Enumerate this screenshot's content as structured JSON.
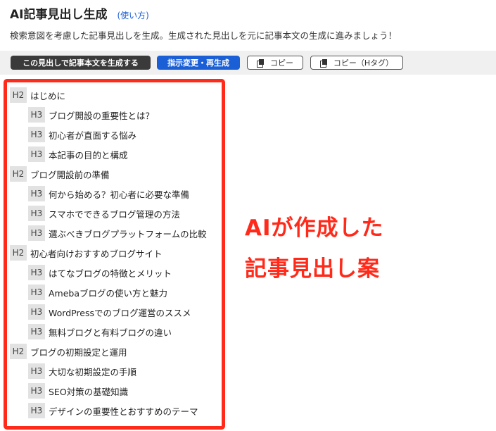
{
  "header": {
    "title": "AI記事見出し生成",
    "howto": "(使い方)"
  },
  "description": "検索意図を考慮した記事見出しを生成。生成された見出しを元に記事本文の生成に進みましょう！",
  "toolbar": {
    "generate_label": "この見出しで記事本文を生成する",
    "regenerate_label": "指示変更・再生成",
    "copy_label": "コピー",
    "copy_h_label": "コピー（Hタグ）"
  },
  "headings": [
    {
      "tag": "H2",
      "text": "はじめに"
    },
    {
      "tag": "H3",
      "text": "ブログ開設の重要性とは？"
    },
    {
      "tag": "H3",
      "text": "初心者が直面する悩み"
    },
    {
      "tag": "H3",
      "text": "本記事の目的と構成"
    },
    {
      "tag": "H2",
      "text": "ブログ開設前の準備"
    },
    {
      "tag": "H3",
      "text": "何から始める？初心者に必要な準備"
    },
    {
      "tag": "H3",
      "text": "スマホでできるブログ管理の方法"
    },
    {
      "tag": "H3",
      "text": "選ぶべきブログプラットフォームの比較"
    },
    {
      "tag": "H2",
      "text": "初心者向けおすすめブログサイト"
    },
    {
      "tag": "H3",
      "text": "はてなブログの特徴とメリット"
    },
    {
      "tag": "H3",
      "text": "Amebaブログの使い方と魅力"
    },
    {
      "tag": "H3",
      "text": "WordPressでのブログ運営のススメ"
    },
    {
      "tag": "H3",
      "text": "無料ブログと有料ブログの違い"
    },
    {
      "tag": "H2",
      "text": "ブログの初期設定と運用"
    },
    {
      "tag": "H3",
      "text": "大切な初期設定の手順"
    },
    {
      "tag": "H3",
      "text": "SEO対策の基礎知識"
    },
    {
      "tag": "H3",
      "text": "デザインの重要性とおすすめのテーマ"
    }
  ],
  "annotation": {
    "line1": "AIが作成した",
    "line2": "記事見出し案"
  },
  "colors": {
    "accent": "#1a5fd6",
    "highlight": "#ff2a1a",
    "dark_button": "#3a3a3a"
  }
}
